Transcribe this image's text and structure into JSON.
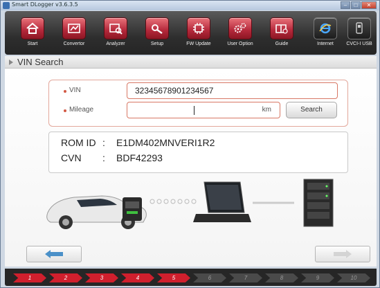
{
  "window": {
    "title": "Smart DLogger v3.6.3.5"
  },
  "toolbar": {
    "items": [
      {
        "label": "Start",
        "icon": "home-icon"
      },
      {
        "label": "Convertor",
        "icon": "converter-icon"
      },
      {
        "label": "Analyzer",
        "icon": "analyzer-icon"
      },
      {
        "label": "Setup",
        "icon": "setup-icon"
      },
      {
        "label": "FW Update",
        "icon": "firmware-icon"
      },
      {
        "label": "User Option",
        "icon": "gears-icon"
      },
      {
        "label": "Guide",
        "icon": "guide-icon"
      }
    ],
    "status": [
      {
        "label": "Internet",
        "icon": "internet-explorer-icon"
      },
      {
        "label": "CVCI-I USB",
        "icon": "usb-device-icon"
      }
    ]
  },
  "section": {
    "title": "VIN Search"
  },
  "form": {
    "vin_label": "VIN",
    "vin_value": "32345678901234567",
    "mileage_label": "Mileage",
    "mileage_value": "",
    "mileage_unit": "km",
    "search_label": "Search"
  },
  "result": {
    "rom_label": "ROM ID",
    "rom_value": "E1DM402MNVERI1R2",
    "cvn_label": "CVN",
    "cvn_value": "BDF42293",
    "separator": ":"
  },
  "steps": {
    "items": [
      "1",
      "2",
      "3",
      "4",
      "5",
      "6",
      "7",
      "8",
      "9",
      "10"
    ],
    "active_count": 5
  },
  "colors": {
    "accent": "#c0313f",
    "field_border": "#d87764",
    "step_active": "#d01f2d",
    "step_inactive": "#4a4a4a"
  }
}
